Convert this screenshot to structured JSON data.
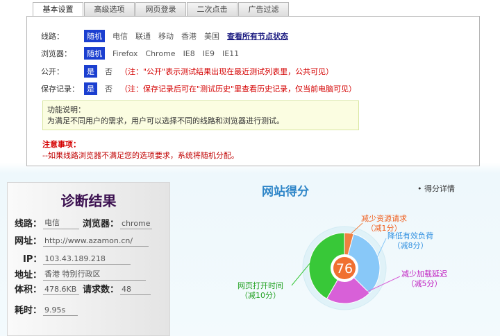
{
  "tabs": [
    "基本设置",
    "高级选项",
    "网页登录",
    "二次点击",
    "广告过滤"
  ],
  "settings": {
    "line": {
      "label": "线路：",
      "options": [
        "随机",
        "电信",
        "联通",
        "移动",
        "香港",
        "美国"
      ],
      "selected": "随机",
      "link": "查看所有节点状态"
    },
    "browser": {
      "label": "浏览器：",
      "options": [
        "随机",
        "Firefox",
        "Chrome",
        "IE8",
        "IE9",
        "IE11"
      ],
      "selected": "随机"
    },
    "public": {
      "label": "公开：",
      "yes": "是",
      "no": "否",
      "note": "（注：\"公开\"表示测试结果出现在最近测试列表里，公共可见）"
    },
    "save": {
      "label": "保存记录：",
      "yes": "是",
      "no": "否",
      "note": "（注：保存记录后可在\"测试历史\"里查看历史记录，仅当前电脑可见）"
    },
    "func_title": "功能说明：",
    "func_text": "为满足不同用户的需求，用户可以选择不同的线路和浏览器进行测试。",
    "warn_title": "注意事项：",
    "warn_text": "--如果线路浏览器不满足您的选项要求，系统将随机分配。"
  },
  "diagnosis": {
    "title": "诊断结果",
    "line_k": "线路：",
    "line_v": "电信",
    "browser_k": "浏览器：",
    "browser_v": "chrome",
    "url_k": "网址：",
    "url_v": "http://www.azamon.cn/",
    "ip_k": "IP：",
    "ip_v": "103.43.189.218",
    "addr_k": "地址：",
    "addr_v": "香港 特别行政区",
    "size_k": "体积：",
    "size_v": "478.6KB",
    "req_k": "请求数：",
    "req_v": "48",
    "time_k": "耗时：",
    "time_v": "9.95s"
  },
  "score": {
    "title": "网站得分",
    "detail": "得分详情",
    "value": "76",
    "segments": [
      {
        "name": "减少资源请求",
        "sub": "（减1分）",
        "deduct": 1,
        "color": "#f08040",
        "text_color": "#f06020"
      },
      {
        "name": "降低有效负荷",
        "sub": "（减8分）",
        "deduct": 8,
        "color": "#88c8f8",
        "text_color": "#3090e0"
      },
      {
        "name": "减少加载延迟",
        "sub": "（减5分）",
        "deduct": 5,
        "color": "#d860d8",
        "text_color": "#c020c0"
      },
      {
        "name": "网页打开时间",
        "sub": "（减10分）",
        "deduct": 10,
        "color": "#38c838",
        "text_color": "#20a020"
      }
    ]
  }
}
